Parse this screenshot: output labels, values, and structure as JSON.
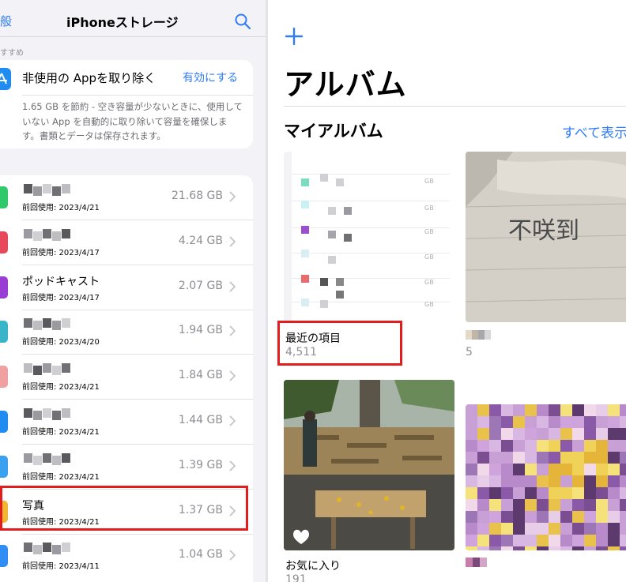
{
  "storage": {
    "back_label": "般",
    "title": "iPhoneストレージ",
    "search_icon": "search-icon",
    "section_header": "すすめ",
    "recommendation": {
      "icon": "app-store-icon",
      "title": "非使用の Appを取り除く",
      "action": "有効にする",
      "description": "1.65 GB を節約 - 空き容量が少ないときに、使用していない App を自動的に取り除いて容量を確保します。書類とデータは保存されます。"
    },
    "apps": [
      {
        "name": "",
        "last_used": "前回使用: 2023/4/21",
        "size": "21.68 GB",
        "icon_color": "#2fc86b"
      },
      {
        "name": "",
        "last_used": "前回使用: 2023/4/17",
        "size": "4.24 GB",
        "icon_color": "#e8485b"
      },
      {
        "name": "ポッドキャスト",
        "last_used": "前回使用: 2023/4/17",
        "size": "2.07 GB",
        "icon_color": "#9a3ed3"
      },
      {
        "name": "",
        "last_used": "前回使用: 2023/4/20",
        "size": "1.94 GB",
        "icon_color": "#39b4c9"
      },
      {
        "name": "",
        "last_used": "前回使用: 2023/4/21",
        "size": "1.84 GB",
        "icon_color": "#f0a0a0"
      },
      {
        "name": "",
        "last_used": "前回使用: 2023/4/21",
        "size": "1.44 GB",
        "icon_color": "#1e8cf0"
      },
      {
        "name": "",
        "last_used": "前回使用: 2023/4/21",
        "size": "1.39 GB",
        "icon_color": "#3aa0f0"
      },
      {
        "name": "写真",
        "last_used": "前回使用: 2023/4/21",
        "size": "1.37 GB",
        "icon_color": "#f2b631"
      },
      {
        "name": "",
        "last_used": "前回使用: 2023/4/11",
        "size": "1.04 GB",
        "icon_color": "#2f8df5"
      }
    ]
  },
  "photos": {
    "add_icon": "plus-icon",
    "title": "アルバム",
    "section": "マイアルバム",
    "see_all": "すべて表示",
    "albums": [
      {
        "name": "最近の項目",
        "count": "4,511"
      },
      {
        "name": "",
        "count": "5"
      },
      {
        "name": "お気に入り",
        "count": "191"
      },
      {
        "name": "",
        "count": ""
      }
    ]
  },
  "colors": {
    "accent": "#2f7cf6",
    "highlight": "#e11d1d",
    "grouped_bg": "#f2f2f7"
  }
}
